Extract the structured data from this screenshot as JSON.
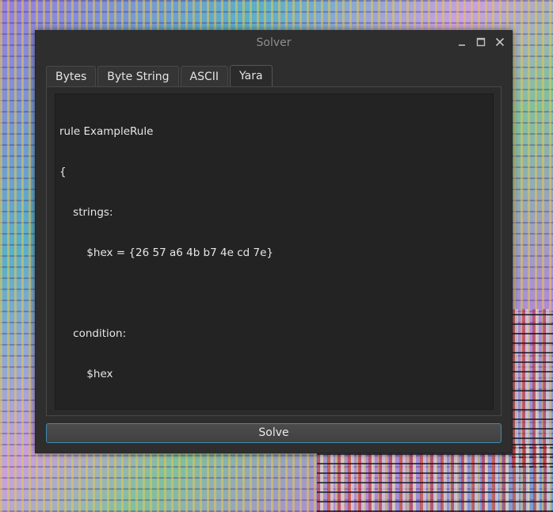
{
  "window": {
    "title": "Solver"
  },
  "tabs": [
    {
      "label": "Bytes",
      "active": false
    },
    {
      "label": "Byte String",
      "active": false
    },
    {
      "label": "ASCII",
      "active": false
    },
    {
      "label": "Yara",
      "active": true
    }
  ],
  "editor": {
    "lines": [
      "rule ExampleRule",
      "{",
      "    strings:",
      "        $hex = {26 57 a6 4b b7 4e cd 7e}",
      "",
      "    condition:",
      "        $hex",
      "}"
    ]
  },
  "solve_button": {
    "label": "Solve"
  },
  "colors": {
    "window_bg": "#2e2e2e",
    "editor_bg": "#232323",
    "button_focus_border": "#3f8ab0"
  },
  "icons": {
    "minimize": "minimize-icon",
    "maximize": "maximize-icon",
    "close": "close-icon"
  }
}
